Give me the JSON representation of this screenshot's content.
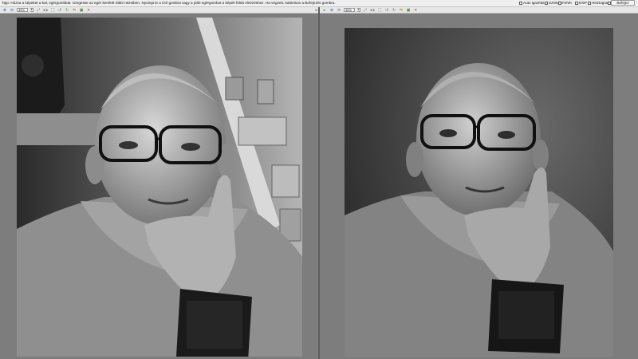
{
  "hint": "Tipp: Húzza a képeket a bal, egérgombbal. Görgesse az egér kerekét többi nézetben. Nyomja le a Ctrl gombot vagy a jobb egérgombot a képek fölött elnézéshez. Ha végzett, kattintson a Befejezés gombra.",
  "options": [
    {
      "label": "Auto igazítás"
    },
    {
      "label": "Színkép"
    },
    {
      "label": "Fehér"
    },
    {
      "label": "EXIF"
    },
    {
      "label": "Hisztogram"
    },
    {
      "label": "..."
    }
  ],
  "finish_label": "Befejez",
  "left_toolbar": {
    "zoom": "39%",
    "ratio": "1:1"
  },
  "right_toolbar": {
    "zoom": "38%",
    "ratio": "1:1"
  },
  "icons": {
    "zoom_in": "zoom-in-icon",
    "zoom_out": "zoom-out-icon",
    "fit": "fit-to-window-icon",
    "rotate_left": "rotate-left-icon",
    "rotate_right": "rotate-right-icon",
    "close": "close-icon"
  },
  "colors": {
    "accent_green": "#3c8c3c",
    "close_red": "#d33333"
  }
}
